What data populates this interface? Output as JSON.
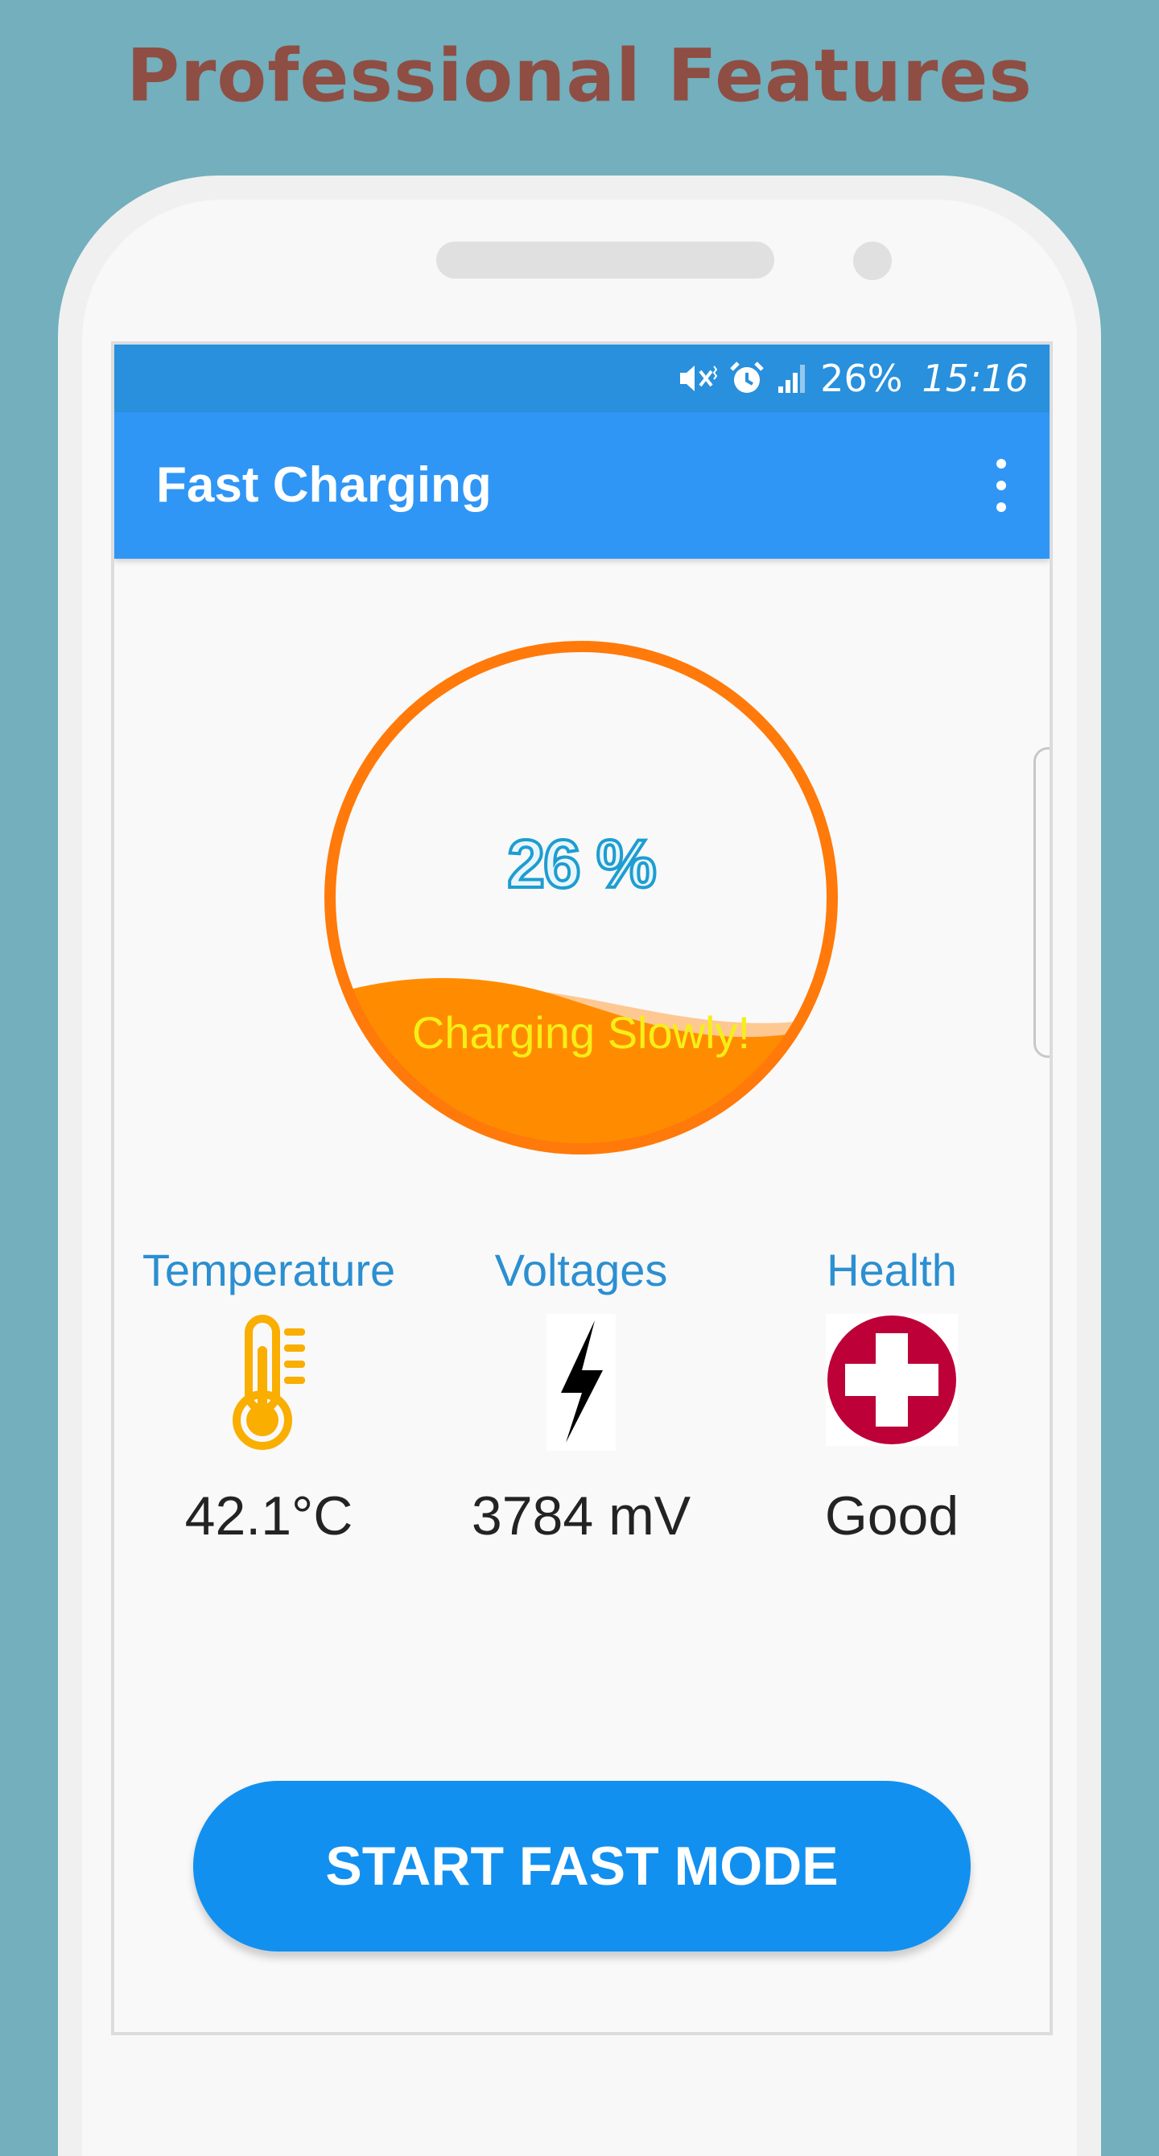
{
  "headline": "Professional Features",
  "status_bar": {
    "battery": "26%",
    "time": "15:16",
    "icons": [
      "mute-vibrate-icon",
      "alarm-icon",
      "signal-icon"
    ]
  },
  "app_bar": {
    "title": "Fast Charging",
    "menu_icon": "more-vert-icon"
  },
  "gauge": {
    "percent_text": "26 %",
    "level": 0.26,
    "status": "Charging Slowly!",
    "ring_color": "#ff7a0a",
    "fill_color": "#ff8c00"
  },
  "stats": [
    {
      "label": "Temperature",
      "icon": "thermometer-icon",
      "value": "42.1°C"
    },
    {
      "label": "Voltages",
      "icon": "lightning-bolt-icon",
      "value": "3784 mV"
    },
    {
      "label": "Health",
      "icon": "red-cross-icon",
      "value": "Good"
    }
  ],
  "start_button": "START FAST MODE",
  "colors": {
    "background": "#73afbc",
    "headline": "#8f4e43",
    "app_bar": "#2f96f6",
    "status_bar": "#2890dc",
    "accent_label": "#2b8fd1",
    "button": "#1290f0"
  }
}
